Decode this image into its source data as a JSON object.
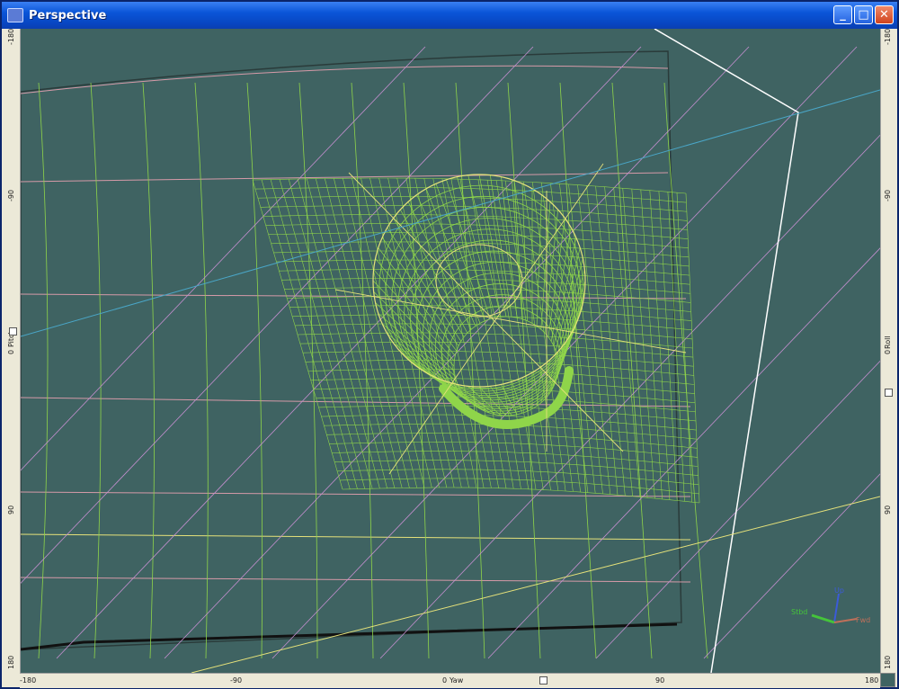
{
  "window": {
    "title": "Perspective",
    "buttons": {
      "minimize": "_",
      "maximize": "□",
      "close": "✕"
    }
  },
  "rulers": {
    "left": [
      "-180",
      "-90",
      "0",
      "90",
      "180"
    ],
    "left_axis_label": "Pitch",
    "right": [
      "-180",
      "-90",
      "0",
      "90",
      "180"
    ],
    "right_axis_label": "Roll",
    "bottom": [
      "-180",
      "-90",
      "0",
      "90",
      "180"
    ],
    "bottom_axis_label": "Yaw"
  },
  "axis_gizmo": {
    "up": "Up",
    "stbd": "Stbd",
    "fwd": "Fwd",
    "colors": {
      "up": "#3b5bd9",
      "stbd": "#45c43a",
      "fwd": "#c0705a"
    }
  },
  "colors": {
    "background": "#3f6362",
    "mesh": "#8fd54a",
    "pink_lines": "#d59aa8",
    "violet_lines": "#c58fd0",
    "yellow_lines": "#e6e27a",
    "cyan_line": "#4aa6c7",
    "white_line": "#ffffff"
  }
}
